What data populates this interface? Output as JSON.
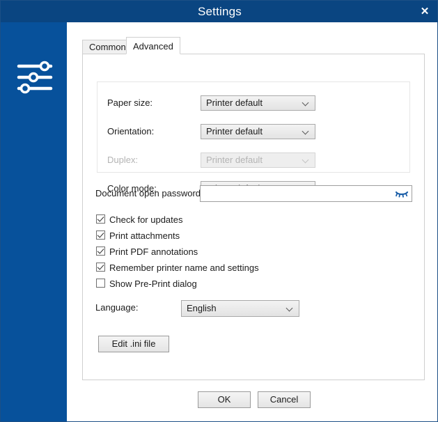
{
  "window": {
    "title": "Settings",
    "close_label": "✕",
    "titlebar_color": "#0a4581",
    "sidebar_color": "#07519b",
    "sidebar_icon": "sliders-icon"
  },
  "tabs": [
    {
      "label": "Common",
      "active": false
    },
    {
      "label": "Advanced",
      "active": true
    }
  ],
  "printer_group": {
    "rows": [
      {
        "label": "Paper size:",
        "value": "Printer default",
        "disabled": false
      },
      {
        "label": "Orientation:",
        "value": "Printer default",
        "disabled": false
      },
      {
        "label": "Duplex:",
        "value": "Printer default",
        "disabled": true
      },
      {
        "label": "Color mode:",
        "value": "Printer default",
        "disabled": false
      }
    ]
  },
  "password": {
    "label": "Document open password:",
    "value": "",
    "placeholder": "",
    "reveal_icon": "eye-closed-icon",
    "reveal_icon_color": "#1c5fa8"
  },
  "checkboxes": [
    {
      "label": "Check for updates",
      "checked": true
    },
    {
      "label": "Print attachments",
      "checked": true
    },
    {
      "label": "Print PDF annotations",
      "checked": true
    },
    {
      "label": "Remember printer name and settings",
      "checked": true
    },
    {
      "label": "Show Pre-Print dialog",
      "checked": false
    }
  ],
  "language": {
    "label": "Language:",
    "value": "English"
  },
  "ini_button": {
    "label": "Edit .ini file"
  },
  "footer": {
    "ok_label": "OK",
    "cancel_label": "Cancel"
  }
}
